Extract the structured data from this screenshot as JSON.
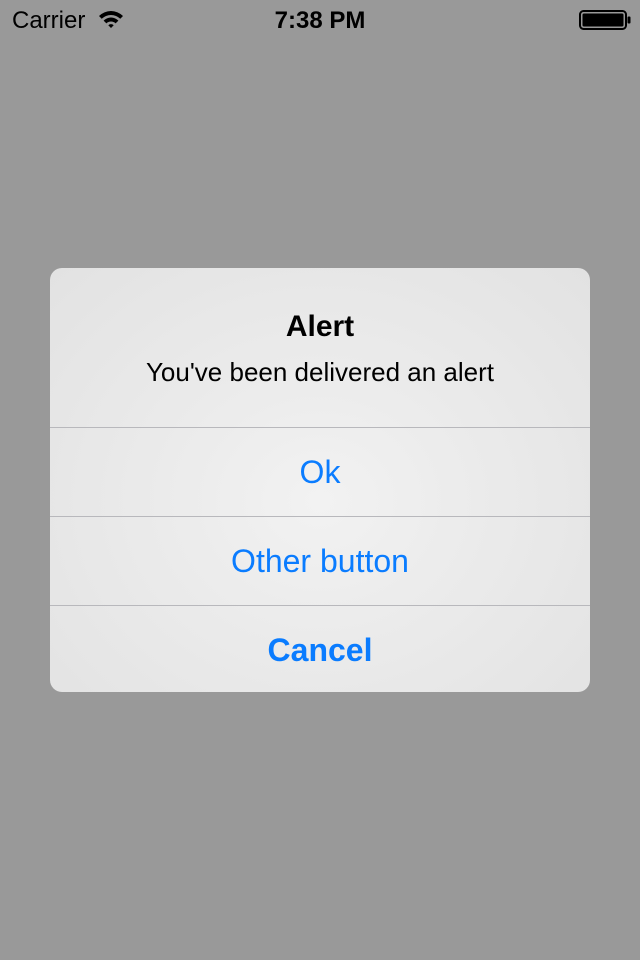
{
  "status_bar": {
    "carrier": "Carrier",
    "time": "7:38 PM",
    "wifi_icon": "wifi-icon",
    "battery_icon": "battery-full-icon"
  },
  "alert": {
    "title": "Alert",
    "message": "You've been delivered an alert",
    "buttons": [
      {
        "label": "Ok"
      },
      {
        "label": "Other button"
      },
      {
        "label": "Cancel"
      }
    ]
  },
  "colors": {
    "dim_background": "#999999",
    "button_tint": "#0a7cff",
    "separator": "#b8b8bc"
  }
}
